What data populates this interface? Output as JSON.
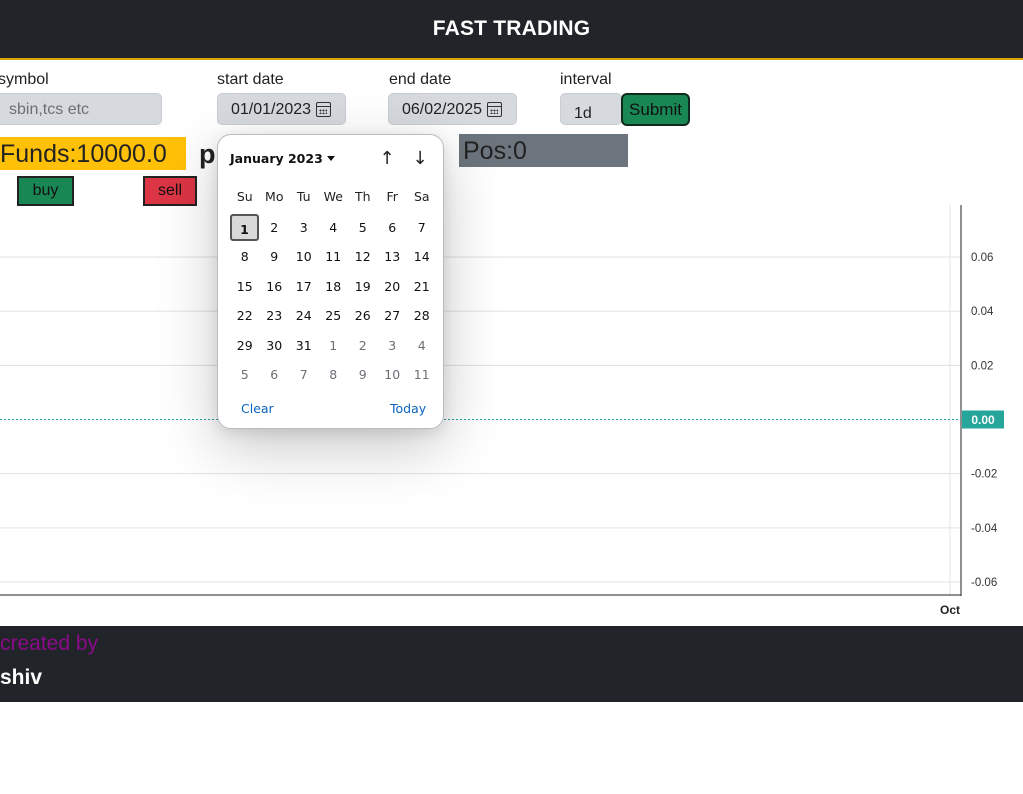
{
  "header": {
    "title": "FAST TRADING"
  },
  "form": {
    "symbol_label": "symbol",
    "symbol_placeholder": "sbin,tcs etc",
    "start_label": "start date",
    "start_value": "01/01/2023",
    "end_label": "end date",
    "end_value": "06/02/2025",
    "interval_label": "interval",
    "interval_value": "1d",
    "submit_label": "Submit"
  },
  "account": {
    "funds": "Funds:10000.0",
    "pnl_fragment": "p",
    "position": "Pos:0",
    "buy_label": "buy",
    "sell_label": "sell"
  },
  "datepicker": {
    "month_label": "January 2023",
    "weekdays": [
      "Su",
      "Mo",
      "Tu",
      "We",
      "Th",
      "Fr",
      "Sa"
    ],
    "weeks": [
      [
        "1",
        "2",
        "3",
        "4",
        "5",
        "6",
        "7"
      ],
      [
        "8",
        "9",
        "10",
        "11",
        "12",
        "13",
        "14"
      ],
      [
        "15",
        "16",
        "17",
        "18",
        "19",
        "20",
        "21"
      ],
      [
        "22",
        "23",
        "24",
        "25",
        "26",
        "27",
        "28"
      ],
      [
        "29",
        "30",
        "31",
        "1",
        "2",
        "3",
        "4"
      ],
      [
        "5",
        "6",
        "7",
        "8",
        "9",
        "10",
        "11"
      ]
    ],
    "selected_day": "1",
    "clear_label": "Clear",
    "today_label": "Today"
  },
  "chart_data": {
    "type": "line",
    "title": "",
    "xlabel": "",
    "ylabel": "",
    "x_ticks": [
      "Oct"
    ],
    "y_ticks": [
      0.06,
      0.04,
      0.02,
      0.0,
      -0.02,
      -0.04,
      -0.06
    ],
    "ylim": [
      -0.06,
      0.06
    ],
    "current_value_label": "0.00",
    "series": [],
    "grid": true,
    "colors": {
      "price_line": "#26a69a",
      "grid": "#e0e0e0",
      "axis": "#222222"
    }
  },
  "footer": {
    "created_by": "created by",
    "author": "shiv"
  },
  "colors": {
    "header_bg": "#212529",
    "accent": "#ffc107",
    "buy": "#198754",
    "sell": "#dc3545",
    "pos_bg": "#6c757d",
    "created_by": "#8a0a8a"
  }
}
